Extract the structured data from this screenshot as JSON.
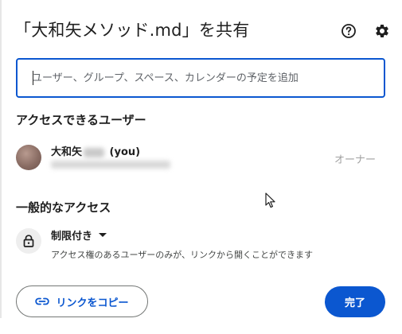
{
  "dialog": {
    "title": "「大和矢メソッド.md」を共有"
  },
  "header": {
    "help_icon": "help-circle-icon",
    "settings_icon": "gear-icon"
  },
  "search": {
    "placeholder": "ユーザー、グループ、スペース、カレンダーの予定を追加"
  },
  "people_access": {
    "heading": "アクセスできるユーザー",
    "users": [
      {
        "name_prefix": "大和矢",
        "name_suffix": "(you)",
        "role": "オーナー"
      }
    ]
  },
  "general_access": {
    "heading": "一般的なアクセス",
    "mode_label": "制限付き",
    "description": "アクセス権のあるユーザーのみが、リンクから開くことができます"
  },
  "footer": {
    "copy_link_label": "リンクをコピー",
    "done_label": "完了"
  },
  "colors": {
    "accent": "#0b57d0",
    "text": "#1f1f1f",
    "muted": "#a0a0a0"
  }
}
